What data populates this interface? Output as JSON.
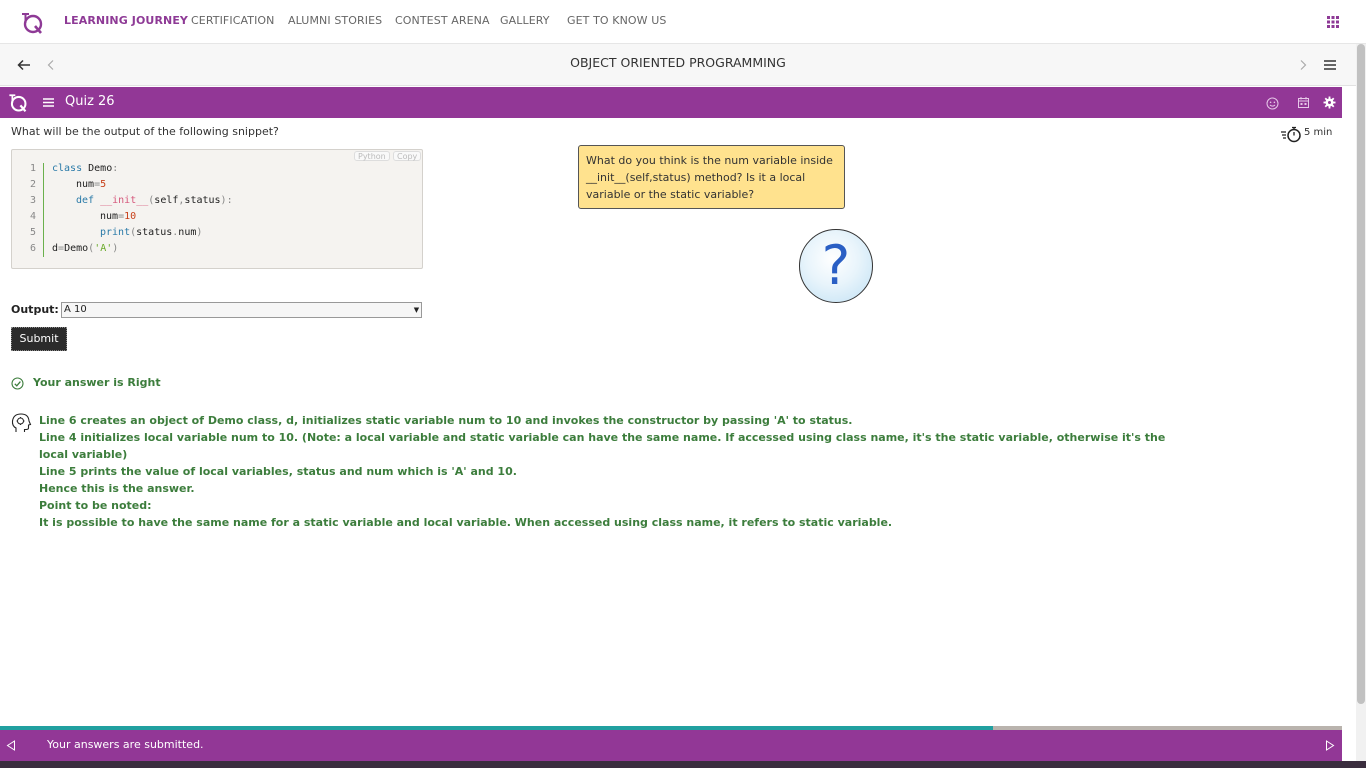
{
  "nav": {
    "items": [
      {
        "label": "LEARNING JOURNEY",
        "active": true
      },
      {
        "label": "CERTIFICATION",
        "active": false
      },
      {
        "label": "ALUMNI STORIES",
        "active": false
      },
      {
        "label": "CONTEST ARENA",
        "active": false
      },
      {
        "label": "GALLERY",
        "active": false
      },
      {
        "label": "GET TO KNOW US",
        "active": false
      }
    ]
  },
  "course": {
    "title": "OBJECT ORIENTED PROGRAMMING"
  },
  "quiz": {
    "title": "Quiz 26",
    "timer": "5 min"
  },
  "question": {
    "text": "What will be the output of the following snippet?"
  },
  "code": {
    "language_label": "Python",
    "copy_label": "Copy",
    "lines": [
      {
        "n": "1"
      },
      {
        "n": "2"
      },
      {
        "n": "3"
      },
      {
        "n": "4"
      },
      {
        "n": "5"
      },
      {
        "n": "6"
      }
    ]
  },
  "hint": {
    "text": "What do you think is the num variable inside __init__(self,status) method? Is it a local variable or the static variable?"
  },
  "answer": {
    "output_label": "Output:",
    "selected_value": "A 10",
    "submit_label": "Submit",
    "result_text": "Your answer is Right"
  },
  "explanation": {
    "lines": [
      "Line 6 creates an object of Demo class, d, initializes static variable num to 10 and invokes the constructor by passing 'A' to status.",
      "Line 4 initializes local variable num to 10. (Note: a local variable and static variable can have the same name. If accessed using class name, it's the static variable, otherwise it's the",
      "local variable)",
      "Line 5 prints the value of local variables, status and num which is 'A' and 10.",
      "Hence this is the answer.",
      "Point to be noted:",
      "It is possible to have the same name for a static variable and local variable. When accessed using class name, it refers to static variable."
    ]
  },
  "footer": {
    "status_text": "Your answers are submitted.",
    "progress": 0.74
  },
  "colors": {
    "brand_purple": "#923796",
    "nav_active": "#8e3a96",
    "success_green": "#3c7d3c",
    "hint_yellow": "#ffe28e",
    "progress_teal": "#21a0a0"
  },
  "icons": [
    "tq-logo",
    "apps-grid-icon",
    "back-arrow-icon",
    "chevron-left-icon",
    "chevron-right-icon",
    "hamburger-menu-icon",
    "smiley-icon",
    "calendar-icon",
    "settings-icon",
    "stopwatch-icon",
    "question-mark-icon",
    "check-circle-icon",
    "thinking-head-icon",
    "play-left-icon",
    "play-right-icon"
  ]
}
